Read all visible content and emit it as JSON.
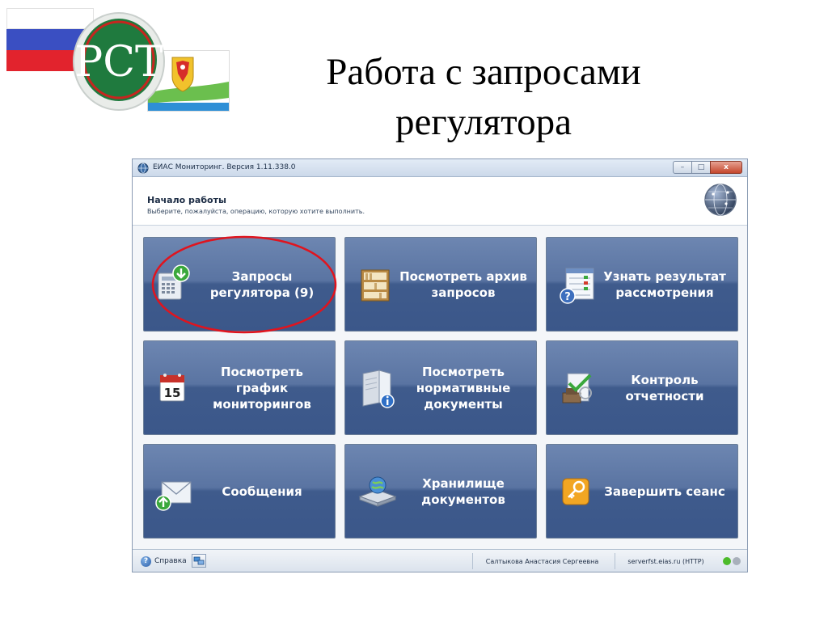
{
  "slide": {
    "title_line1": "Работа с запросами",
    "title_line2": "регулятора",
    "logo_text": "РСТ"
  },
  "window": {
    "title": "ЕИАС Мониторинг. Версия 1.11.338.0",
    "header_title": "Начало работы",
    "header_subtitle": "Выберите, пожалуйста, операцию, которую хотите выполнить.",
    "minimize_glyph": "–",
    "maximize_glyph": "□",
    "close_glyph": "x"
  },
  "tiles": [
    {
      "label": "Запросы регулятора (9)",
      "icon": "regulator-requests-icon"
    },
    {
      "label": "Посмотреть архив запросов",
      "icon": "archive-shelf-icon"
    },
    {
      "label": "Узнать результат рассмотрения",
      "icon": "review-result-icon"
    },
    {
      "label": "Посмотреть график мониторингов",
      "icon": "calendar-icon"
    },
    {
      "label": "Посмотреть нормативные документы",
      "icon": "normative-documents-icon"
    },
    {
      "label": "Контроль отчетности",
      "icon": "report-control-icon"
    },
    {
      "label": "Сообщения",
      "icon": "envelope-icon"
    },
    {
      "label": "Хранилище документов",
      "icon": "document-storage-icon"
    },
    {
      "label": "Завершить сеанс",
      "icon": "key-icon"
    }
  ],
  "calendar_day": "15",
  "statusbar": {
    "help_label": "Справка",
    "help_glyph": "?",
    "user": "Салтыкова Анастасия Сергеевна",
    "server": "serverfst.eias.ru (HTTP)"
  },
  "colors": {
    "tile_top": "#6d86b1",
    "tile_bottom": "#3b578a",
    "highlight_ellipse": "#e0141e",
    "status_led_green": "#4cbb2a",
    "status_led_gray": "#a8b0bb"
  }
}
